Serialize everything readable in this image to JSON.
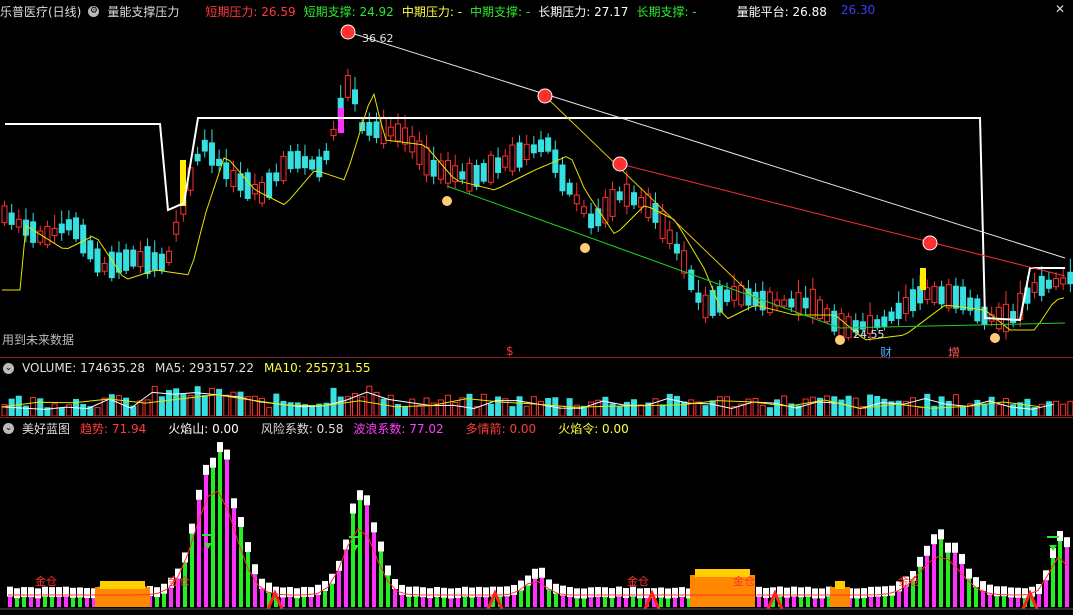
{
  "main_header": {
    "stock_name": "乐普医疗(日线)",
    "indicator": "量能支撑压力",
    "items": [
      {
        "label": "短期压力: 26.59",
        "color": "#ff3b3b"
      },
      {
        "label": "短期支撑: 24.92",
        "color": "#2ee82e"
      },
      {
        "label": "中期压力: -",
        "color": "#ffff40"
      },
      {
        "label": "中期支撑: -",
        "color": "#2ee82e"
      },
      {
        "label": "长期压力: 27.17",
        "color": "#ffffff"
      },
      {
        "label": "长期支撑: -",
        "color": "#2ee82e"
      },
      {
        "label": "量能平台: 26.88",
        "color": "#ffffff"
      },
      {
        "label": "26.30",
        "color": "#3a3aff"
      }
    ]
  },
  "main_chart": {
    "price_high_label": "36.62",
    "price_low_label": "24.55",
    "future_data_note": "用到未来数据",
    "markers": [
      {
        "text": "$",
        "color": "#ff3333"
      },
      {
        "text": "财",
        "color": "#4aa3ff"
      },
      {
        "text": "增",
        "color": "#ff6060"
      }
    ]
  },
  "volume_header": {
    "items": [
      {
        "label": "VOLUME: 174635.28",
        "color": "#e0e0e0"
      },
      {
        "label": "MA5: 293157.22",
        "color": "#e0e0e0"
      },
      {
        "label": "MA10: 255731.55",
        "color": "#ffff40"
      }
    ]
  },
  "indicator_header": {
    "name": "美好蓝图",
    "items": [
      {
        "label": "趋势: 71.94",
        "color": "#ff3b3b"
      },
      {
        "label": "火焰山: 0.00",
        "color": "#ffffff"
      },
      {
        "label": "风险系数: 0.58",
        "color": "#dddddd"
      },
      {
        "label": "波浪系数: 77.02",
        "color": "#ff40ff"
      },
      {
        "label": "多情箭: 0.00",
        "color": "#ff3b3b"
      },
      {
        "label": "火焰令: 0.00",
        "color": "#ffff40"
      }
    ]
  },
  "indicator_chart": {
    "gold_label": "金仓"
  },
  "colors": {
    "up": "#ff3030",
    "down": "#36e0e0",
    "long_line": "#ffffff",
    "ma": "#e6e600",
    "support": "#22cc22",
    "resist": "#ff3030",
    "magenta": "#ff30ff",
    "green": "#22ee22"
  },
  "icons": {
    "close": "close-icon",
    "settings": "gear-icon"
  }
}
